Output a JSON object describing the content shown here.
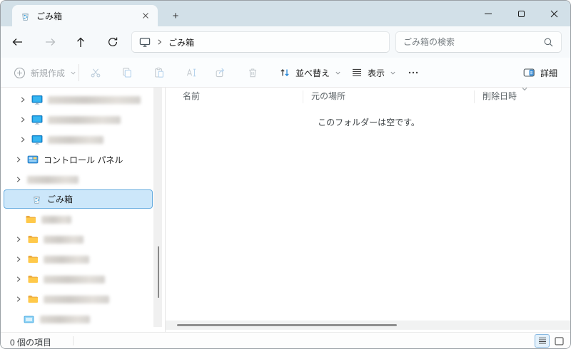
{
  "titlebar": {
    "tab": {
      "title": "ごみ箱",
      "icon": "recycle-bin-icon"
    },
    "new_tab_icon": "plus-icon",
    "new_tab_glyph": "+",
    "window_controls": [
      "minimize",
      "maximize",
      "close"
    ]
  },
  "navbar": {
    "back_icon": "arrow-left-icon",
    "forward_icon": "arrow-right-icon",
    "up_icon": "arrow-up-icon",
    "refresh_icon": "refresh-icon",
    "address": {
      "location_icon": "desktop-icon",
      "path": "ごみ箱"
    },
    "search": {
      "placeholder": "ごみ箱の検索",
      "icon": "search-icon"
    }
  },
  "toolbar": {
    "new_button": {
      "label": "新規作成",
      "disabled": true
    },
    "action_icons": [
      "cut",
      "copy",
      "paste",
      "rename",
      "share",
      "delete"
    ],
    "sort_button": {
      "label": "並べ替え"
    },
    "view_button": {
      "label": "表示"
    },
    "more_icon": "ellipsis-icon",
    "details_button": {
      "label": "詳細"
    }
  },
  "sidebar": {
    "items": [
      {
        "type": "computer",
        "redacted": true,
        "expandable": true
      },
      {
        "type": "computer",
        "redacted": true,
        "expandable": true
      },
      {
        "type": "computer",
        "redacted": true,
        "expandable": true
      },
      {
        "type": "control-panel",
        "label": "コントロール パネル",
        "expandable": true
      },
      {
        "type": "unknown",
        "redacted": true,
        "expandable": true
      },
      {
        "type": "recycle-bin",
        "label": "ごみ箱",
        "selected": true
      },
      {
        "type": "folder",
        "redacted": true
      },
      {
        "type": "folder",
        "redacted": true,
        "expandable": true
      },
      {
        "type": "folder",
        "redacted": true,
        "expandable": true
      },
      {
        "type": "folder",
        "redacted": true,
        "expandable": true
      },
      {
        "type": "folder",
        "redacted": true,
        "expandable": true
      },
      {
        "type": "network",
        "redacted": true
      }
    ]
  },
  "main": {
    "columns": [
      "名前",
      "元の場所",
      "削除日時"
    ],
    "sort_indicator": {
      "column": "削除日時",
      "icon": "chevron-down-icon"
    },
    "empty_message": "このフォルダーは空です。"
  },
  "statusbar": {
    "item_count": "0 個の項目",
    "view_toggles": [
      "details-view",
      "icons-view"
    ],
    "selected_view": "details-view"
  },
  "colors": {
    "titlebar_bg": "#d2e0e8",
    "selection_bg": "#cce7fa",
    "selection_border": "#67ade0",
    "accent_blue": "#1a7fd4"
  }
}
